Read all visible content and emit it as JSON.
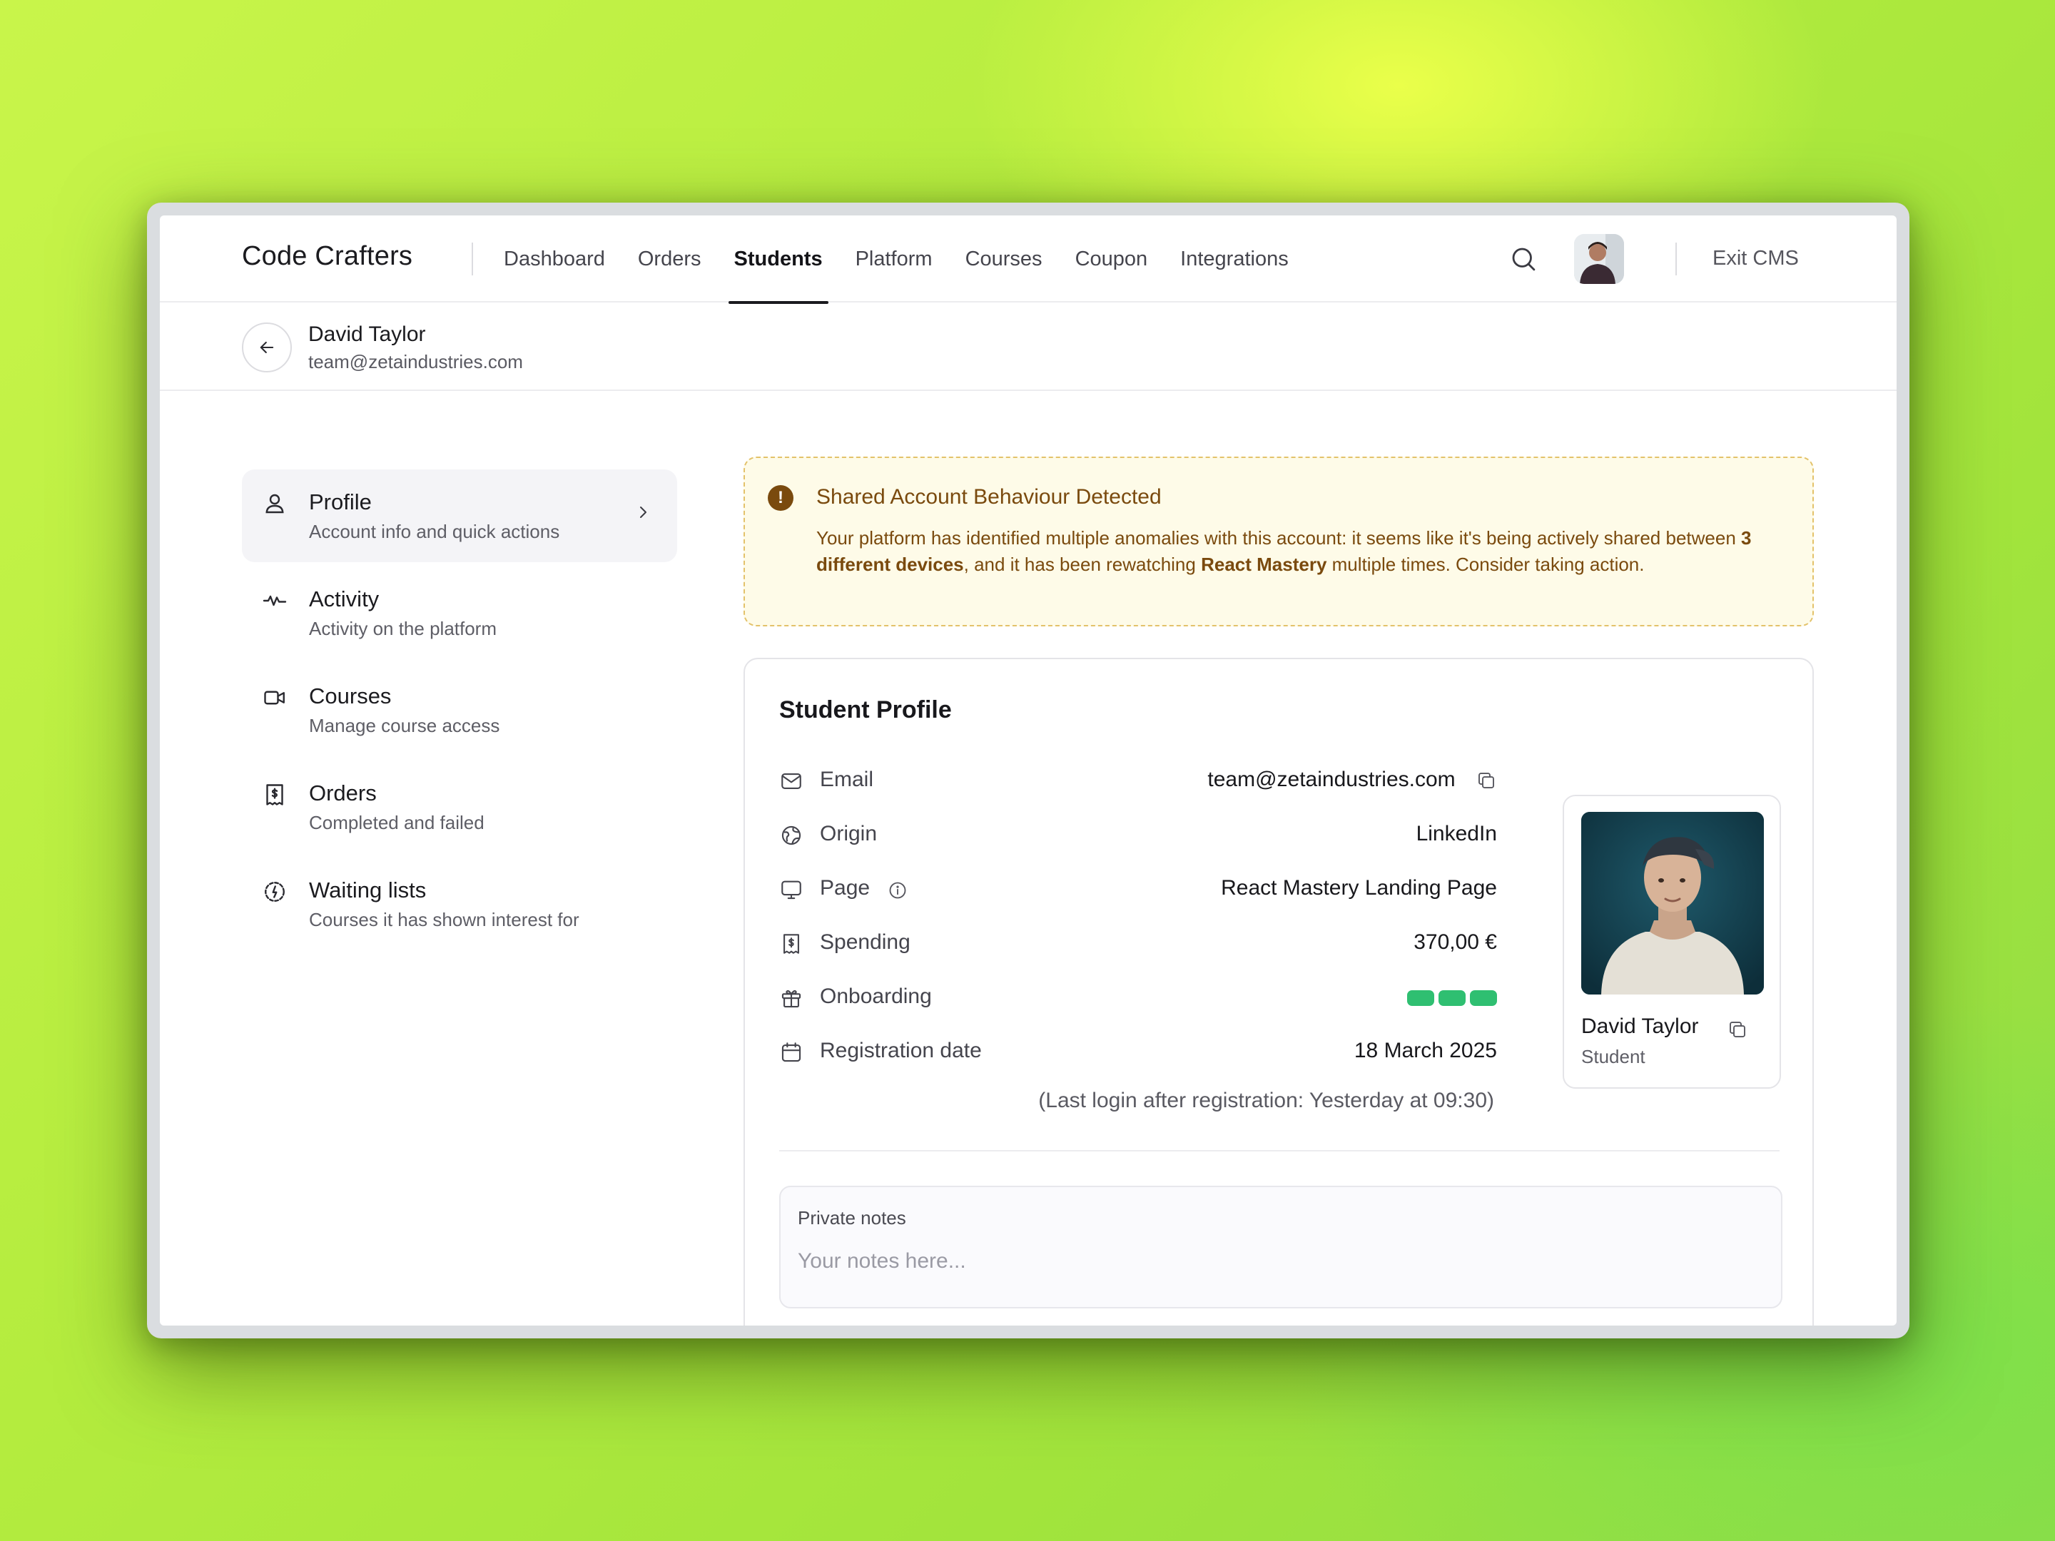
{
  "nav": {
    "brand": "Code Crafters",
    "links": [
      "Dashboard",
      "Orders",
      "Students",
      "Platform",
      "Courses",
      "Coupon",
      "Integrations"
    ],
    "active": "Students",
    "exit_label": "Exit CMS"
  },
  "header": {
    "name": "David Taylor",
    "email": "team@zetaindustries.com"
  },
  "sidebar": {
    "items": [
      {
        "title": "Profile",
        "desc": "Account info and quick actions",
        "icon": "user-icon",
        "active": true
      },
      {
        "title": "Activity",
        "desc": "Activity on the platform",
        "icon": "activity-icon",
        "active": false
      },
      {
        "title": "Courses",
        "desc": "Manage course access",
        "icon": "video-icon",
        "active": false
      },
      {
        "title": "Orders",
        "desc": "Completed and failed",
        "icon": "receipt-icon",
        "active": false
      },
      {
        "title": "Waiting lists",
        "desc": "Courses it has shown interest for",
        "icon": "clock-icon",
        "active": false
      }
    ]
  },
  "alert": {
    "title": "Shared Account Behaviour Detected",
    "body_1": "Your platform has identified multiple anomalies with this account: it seems like it's being actively shared between ",
    "body_bold_1": "3 different devices",
    "body_2": ", and it has been rewatching ",
    "body_bold_2": "React Mastery",
    "body_3": " multiple times. Consider taking action.",
    "color": "#7a4a0e",
    "background": "#fefbe8"
  },
  "profile": {
    "title": "Student Profile",
    "fields": {
      "email": {
        "label": "Email",
        "value": "team@zetaindustries.com"
      },
      "origin": {
        "label": "Origin",
        "value": "LinkedIn"
      },
      "page": {
        "label": "Page",
        "value": "React Mastery Landing Page"
      },
      "spending": {
        "label": "Spending",
        "value": "370,00 €"
      },
      "onboarding": {
        "label": "Onboarding",
        "steps_completed": 3,
        "steps_total": 3,
        "color": "#2fbf71"
      },
      "registration": {
        "label": "Registration date",
        "value": "18 March 2025"
      }
    },
    "last_login": "(Last login after registration: Yesterday at 09:30)",
    "card": {
      "name": "David Taylor",
      "role": "Student"
    },
    "notes": {
      "label": "Private notes",
      "value": "",
      "placeholder": "Your notes here..."
    }
  }
}
